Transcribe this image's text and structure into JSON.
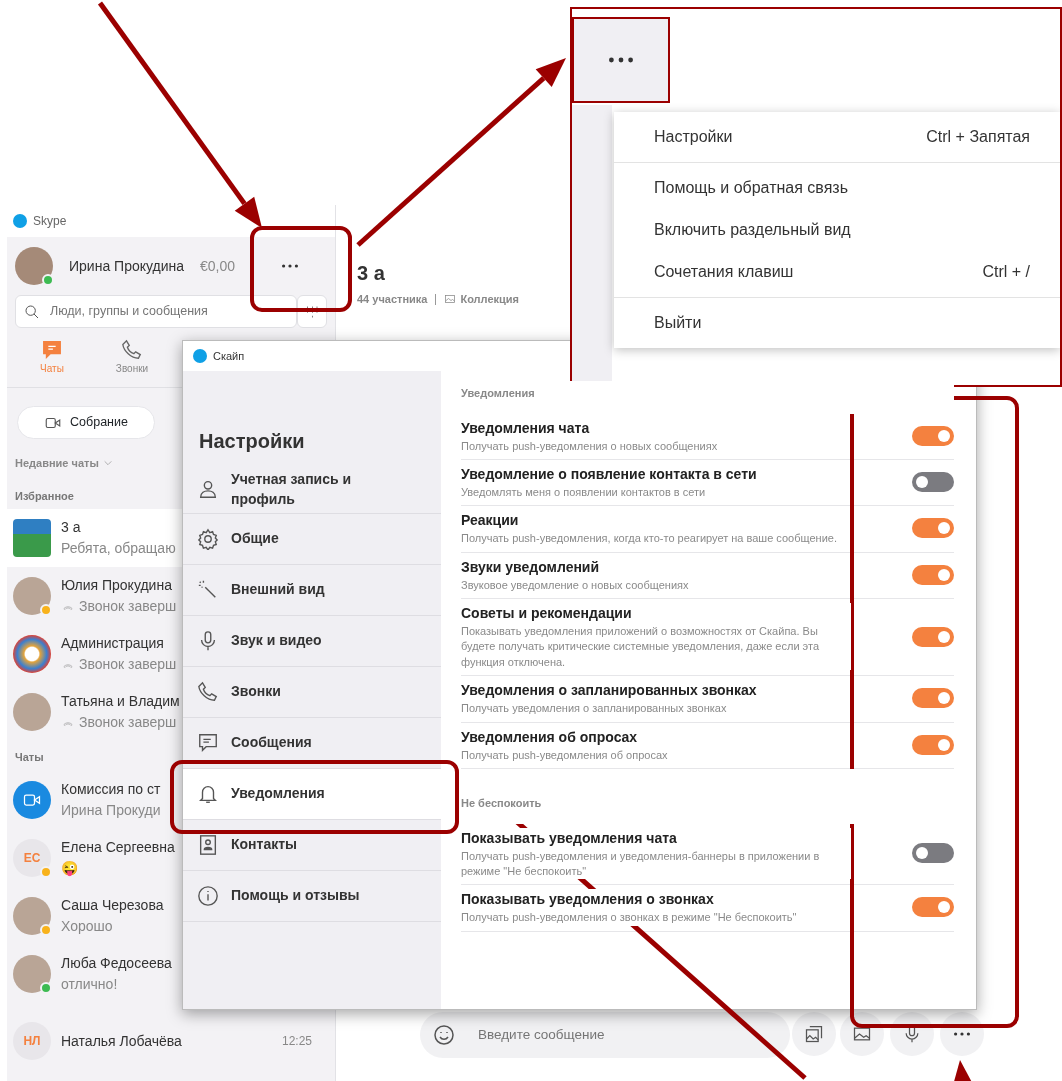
{
  "app_title": "Skype",
  "profile": {
    "name": "Ирина Прокудина",
    "balance": "€0,00",
    "color": "#3dbb52"
  },
  "search": {
    "placeholder": "Люди, группы и сообщения"
  },
  "nav_tabs": [
    {
      "label": "Чаты",
      "kind": "chat",
      "selected": true
    },
    {
      "label": "Звонки",
      "kind": "call",
      "selected": false
    }
  ],
  "meeting_button": "Собрание",
  "recent_label": "Недавние чаты",
  "sections": [
    {
      "title": "Избранное",
      "chats": [
        {
          "name": "3 а",
          "preview": "Ребята, обращаю",
          "kind": "picture",
          "call": false,
          "selected": true
        },
        {
          "name": "Юлия Прокудина",
          "preview": "Звонок заверш",
          "kind": "photo",
          "color": "#f8b21b",
          "call": true,
          "selected": false
        },
        {
          "name": "Администрация",
          "preview": "Звонок заверш",
          "kind": "emblem",
          "call": true,
          "selected": false
        },
        {
          "name": "Татьяна и Владим",
          "preview": "Звонок заверш",
          "kind": "photo",
          "call": true,
          "selected": false
        }
      ]
    },
    {
      "title": "Чаты",
      "chats": [
        {
          "name": "Комиссия по ст",
          "preview": "Ирина Прокуди",
          "kind": "video",
          "call": false,
          "selected": false
        },
        {
          "name": "Елена Сергеевна",
          "preview": "😜",
          "kind": "initials",
          "initials": "ЕС",
          "color": "#f8b21b",
          "call": false,
          "selected": false
        },
        {
          "name": "Саша Черезова",
          "preview": "Хорошо",
          "kind": "photo",
          "color": "#f8b21b",
          "call": false,
          "selected": false
        },
        {
          "name": "Люба Федосеева",
          "preview": "отлично!",
          "kind": "photo",
          "color": "#3dbb52",
          "call": false,
          "selected": false
        },
        {
          "name": "Наталья Лобачёва",
          "time": "12:25",
          "kind": "initials",
          "initials": "НЛ",
          "selected": false
        }
      ]
    }
  ],
  "chat_header": {
    "title": "3 а",
    "members": "44 участника",
    "collection": "Коллекция"
  },
  "composer": {
    "placeholder": "Введите сообщение"
  },
  "settings_window": {
    "title": "Скайп",
    "heading": "Настройки",
    "nav": [
      {
        "label": "Учетная запись и профиль",
        "selected": false
      },
      {
        "label": "Общие",
        "selected": false
      },
      {
        "label": "Внешний вид",
        "selected": false
      },
      {
        "label": "Звук и видео",
        "selected": false
      },
      {
        "label": "Звонки",
        "selected": false
      },
      {
        "label": "Сообщения",
        "selected": false
      },
      {
        "label": "Уведомления",
        "selected": true
      },
      {
        "label": "Контакты",
        "selected": false
      },
      {
        "label": "Помощь и отзывы",
        "selected": false
      }
    ],
    "groups": [
      {
        "title": "Уведомления",
        "items": [
          {
            "title": "Уведомления чата",
            "description": "Получать push-уведомления о новых сообщениях",
            "on": true
          },
          {
            "title": "Уведомление о появление контакта в сети",
            "description": "Уведомлять меня о появлении контактов в сети",
            "on": false
          },
          {
            "title": "Реакции",
            "description": "Получать push-уведомления, когда кто-то реагирует на ваше сообщение.",
            "on": true
          },
          {
            "title": "Звуки уведомлений",
            "description": "Звуковое уведомление о новых сообщениях",
            "on": true
          },
          {
            "title": "Советы и рекомендации",
            "description": "Показывать уведомления приложений о возможностях от Скайпа. Вы будете получать критические системные уведомления, даже если эта функция отключена.",
            "on": true
          },
          {
            "title": "Уведомления о запланированных звонках",
            "description": "Получать уведомления о запланированных звонках",
            "on": true
          },
          {
            "title": "Уведомления об опросах",
            "description": "Получать push-уведомления об опросах",
            "on": true
          }
        ]
      },
      {
        "title": "Не беспокоить",
        "items": [
          {
            "title": "Показывать уведомления чата",
            "description": "Получать push-уведомления и уведомления-баннеры в приложении в режиме \"Не беспокоить\"",
            "on": false
          },
          {
            "title": "Показывать уведомления о звонках",
            "description": "Получать push-уведомления о звонках в режиме \"Не беспокоить\"",
            "on": true
          }
        ]
      }
    ]
  },
  "menu_popup": {
    "items": [
      {
        "label": "Настройки",
        "shortcut": "Ctrl + Запятая",
        "divider_after": true
      },
      {
        "label": "Помощь и обратная связь",
        "divider_after": false
      },
      {
        "label": "Включить раздельный вид",
        "divider_after": false
      },
      {
        "label": "Сочетания клавиш",
        "shortcut": "Ctrl + /",
        "divider_after": true
      },
      {
        "label": "Выйти",
        "divider_after": false
      }
    ]
  }
}
